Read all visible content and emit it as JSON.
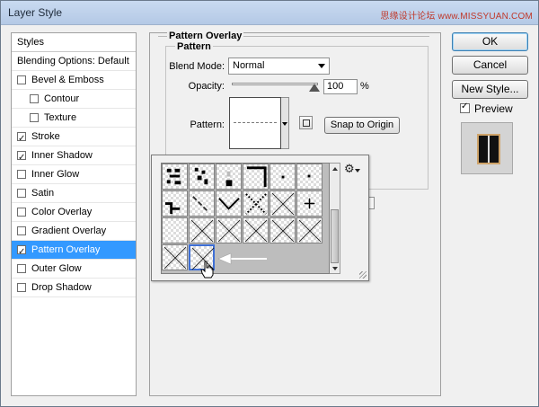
{
  "window": {
    "title": "Layer Style",
    "watermark": "思缘设计论坛 www.MISSYUAN.COM"
  },
  "styles_panel": {
    "header": "Styles",
    "blending_options": "Blending Options: Default",
    "items": [
      {
        "label": "Bevel & Emboss",
        "checked": false,
        "indent": 0,
        "selected": false
      },
      {
        "label": "Contour",
        "checked": false,
        "indent": 1,
        "selected": false
      },
      {
        "label": "Texture",
        "checked": false,
        "indent": 1,
        "selected": false
      },
      {
        "label": "Stroke",
        "checked": true,
        "indent": 0,
        "selected": false
      },
      {
        "label": "Inner Shadow",
        "checked": true,
        "indent": 0,
        "selected": false
      },
      {
        "label": "Inner Glow",
        "checked": false,
        "indent": 0,
        "selected": false
      },
      {
        "label": "Satin",
        "checked": false,
        "indent": 0,
        "selected": false
      },
      {
        "label": "Color Overlay",
        "checked": false,
        "indent": 0,
        "selected": false
      },
      {
        "label": "Gradient Overlay",
        "checked": false,
        "indent": 0,
        "selected": false
      },
      {
        "label": "Pattern Overlay",
        "checked": true,
        "indent": 0,
        "selected": true
      },
      {
        "label": "Outer Glow",
        "checked": false,
        "indent": 0,
        "selected": false
      },
      {
        "label": "Drop Shadow",
        "checked": false,
        "indent": 0,
        "selected": false
      }
    ]
  },
  "pattern_overlay": {
    "group_title": "Pattern Overlay",
    "subgroup_title": "Pattern",
    "blend_mode_label": "Blend Mode:",
    "blend_mode_value": "Normal",
    "opacity_label": "Opacity:",
    "opacity_value": "100",
    "opacity_unit": "%",
    "opacity_level": 1.0,
    "pattern_label": "Pattern:",
    "snap_button": "Snap to Origin"
  },
  "pattern_picker": {
    "selected_index": 13,
    "menu_icon": "gear-icon"
  },
  "buttons": {
    "ok": "OK",
    "cancel": "Cancel",
    "new_style": "New Style..."
  },
  "preview": {
    "label": "Preview",
    "checked": true
  },
  "colors": {
    "selection": "#3399ff",
    "selected_cell_border": "#3e6fd6",
    "default_button_border": "#3c7fb1"
  }
}
